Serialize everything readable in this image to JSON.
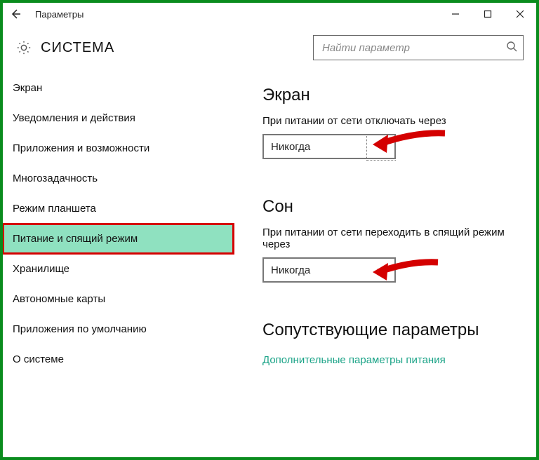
{
  "window": {
    "title": "Параметры"
  },
  "header": {
    "page_title": "СИСТЕМА",
    "search_placeholder": "Найти параметр"
  },
  "sidebar": {
    "items": [
      {
        "label": "Экран"
      },
      {
        "label": "Уведомления и действия"
      },
      {
        "label": "Приложения и возможности"
      },
      {
        "label": "Многозадачность"
      },
      {
        "label": "Режим планшета"
      },
      {
        "label": "Питание и спящий режим"
      },
      {
        "label": "Хранилище"
      },
      {
        "label": "Автономные карты"
      },
      {
        "label": "Приложения по умолчанию"
      },
      {
        "label": "О системе"
      }
    ],
    "active_index": 5
  },
  "main": {
    "screen": {
      "heading": "Экран",
      "label": "При питании от сети отключать через",
      "value": "Никогда"
    },
    "sleep": {
      "heading": "Сон",
      "label": "При питании от сети переходить в спящий режим через",
      "value": "Никогда"
    },
    "related": {
      "heading": "Сопутствующие параметры",
      "link": "Дополнительные параметры питания"
    }
  }
}
